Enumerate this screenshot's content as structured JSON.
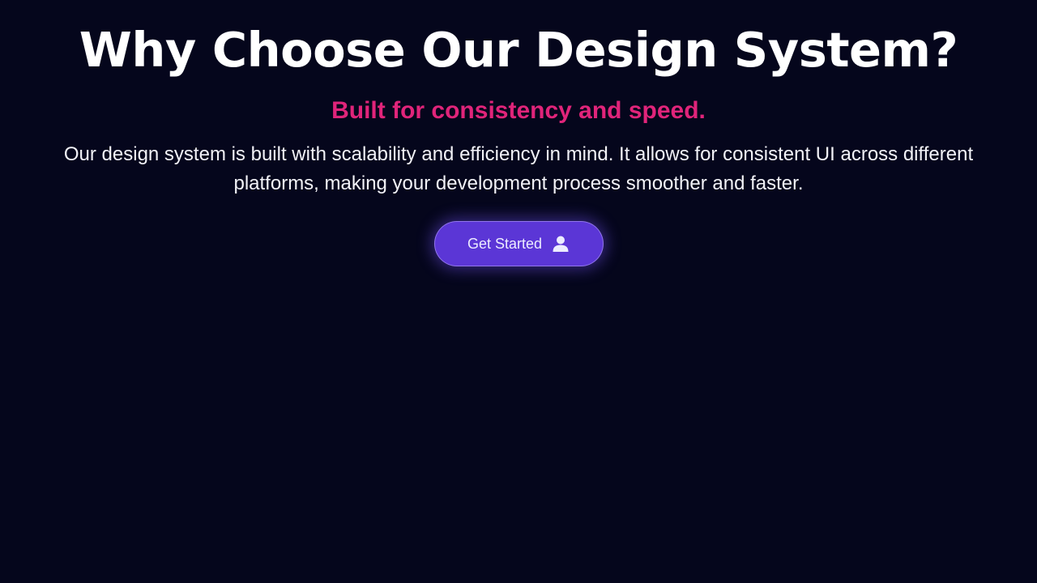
{
  "hero": {
    "title": "Why Choose Our Design System?",
    "subtitle": "Built for consistency and speed.",
    "description": "Our design system is built with scalability and efficiency in mind. It allows for consistent UI across different platforms, making your development process smoother and faster."
  },
  "cta": {
    "label": "Get Started",
    "icon": "user-icon"
  },
  "colors": {
    "background": "#05061c",
    "title": "#ffffff",
    "subtitle": "#e0247a",
    "button": "#5b36d6"
  }
}
